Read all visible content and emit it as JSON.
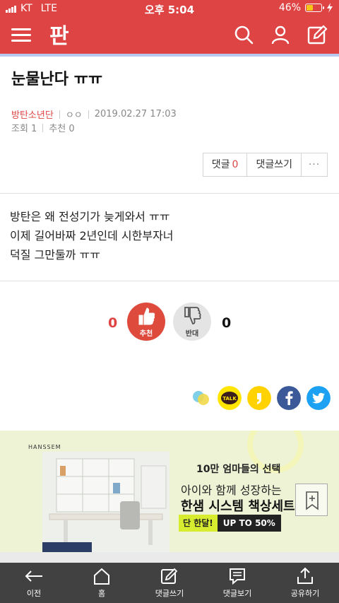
{
  "status_bar": {
    "carrier": "KT",
    "network": "LTE",
    "time": "오후 5:04",
    "battery": "46%",
    "battery_level": 0.46
  },
  "header": {
    "logo": "판",
    "icons": [
      "menu-icon",
      "search-icon",
      "user-icon",
      "write-icon"
    ],
    "accent": "#de4444"
  },
  "post": {
    "title": "눈물난다 ㅠㅠ",
    "author": "방탄소년단",
    "nickname": "ㅇㅇ",
    "date": "2019.02.27 17:03",
    "views": "조회 1",
    "recommend": "추천 0"
  },
  "comment_actions": {
    "comments_label": "댓글",
    "comments_count": "0",
    "write_comment": "댓글쓰기",
    "more": "···"
  },
  "body": {
    "lines": [
      "방탄은 왜 전성기가 늦게와서 ㅠㅠ",
      "이제 길어바짜 2년인데 시한부자너",
      "덕질 그만둘까 ㅠㅠ"
    ]
  },
  "votes": {
    "up_count": "0",
    "up_label": "추천",
    "down_label": "반대",
    "down_count": "0"
  },
  "share": {
    "icons": [
      "kakaostory-icon",
      "kakaotalk-icon",
      "kakaopage-icon",
      "facebook-icon",
      "twitter-icon"
    ],
    "talk_label": "TALK"
  },
  "ad": {
    "brand": "HANSSEM",
    "tagline": "10만 엄마들의 선택",
    "headline1": "아이와 함께 성장하는",
    "headline2": "한샘 시스템 책상세트",
    "offer_label": "단 한달!",
    "offer_value": "UP TO 50%"
  },
  "bottom_nav": {
    "items": [
      {
        "label": "이전",
        "icon": "back-arrow-icon"
      },
      {
        "label": "홈",
        "icon": "home-icon"
      },
      {
        "label": "댓글쓰기",
        "icon": "write-comment-icon"
      },
      {
        "label": "댓글보기",
        "icon": "view-comments-icon"
      },
      {
        "label": "공유하기",
        "icon": "share-icon"
      }
    ]
  }
}
